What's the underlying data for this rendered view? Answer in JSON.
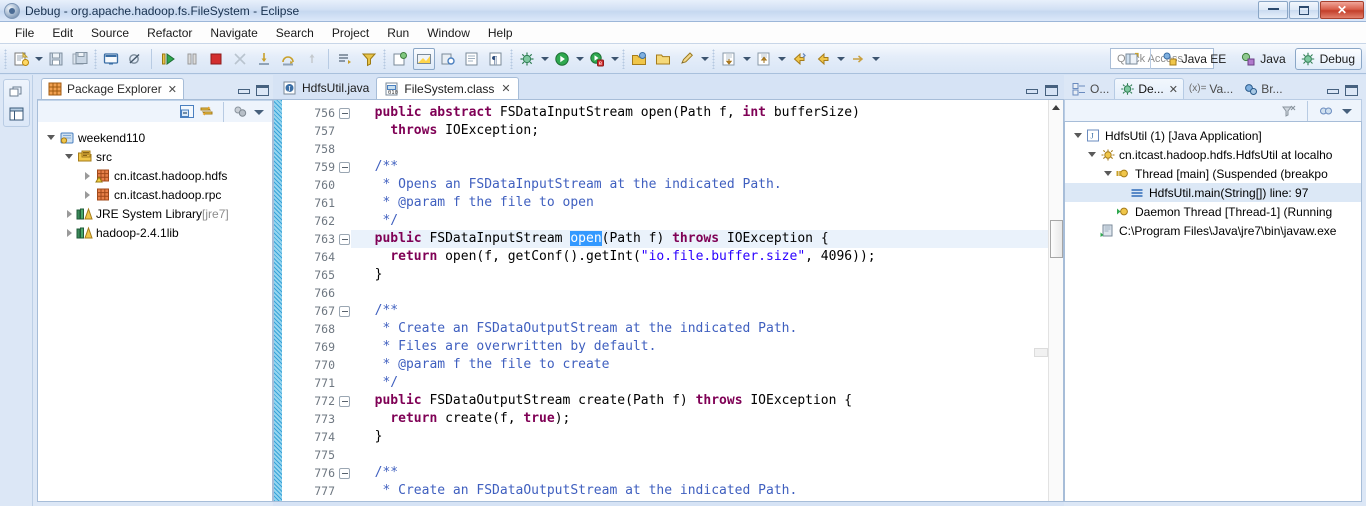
{
  "window": {
    "title": "Debug - org.apache.hadoop.fs.FileSystem - Eclipse",
    "icon": "eclipse-icon",
    "minimize_label": "",
    "maximize_label": "",
    "close_label": "✕"
  },
  "menubar": {
    "items": [
      {
        "label": "File",
        "accel": "F"
      },
      {
        "label": "Edit",
        "accel": "E"
      },
      {
        "label": "Source",
        "accel": "S"
      },
      {
        "label": "Refactor",
        "accel": "t"
      },
      {
        "label": "Navigate",
        "accel": "N"
      },
      {
        "label": "Search",
        "accel": "a"
      },
      {
        "label": "Project",
        "accel": "P"
      },
      {
        "label": "Run",
        "accel": "R"
      },
      {
        "label": "Window",
        "accel": "W"
      },
      {
        "label": "Help",
        "accel": "H"
      }
    ]
  },
  "toolbar": {
    "quick_access_placeholder": "Quick Access",
    "perspectives": [
      {
        "label": "Java EE",
        "icon": "java-ee-perspective-icon",
        "active": false
      },
      {
        "label": "Java",
        "icon": "java-perspective-icon",
        "active": false
      },
      {
        "label": "Debug",
        "icon": "debug-perspective-icon",
        "active": true
      }
    ],
    "open_perspective_icon": "open-perspective-icon",
    "buttons": [
      "new-wizard-icon",
      "save-icon",
      "save-all-icon",
      "console-icon",
      "skip-breakpoints-icon",
      "resume-icon",
      "suspend-icon",
      "terminate-icon",
      "disconnect-icon",
      "step-into-icon",
      "step-over-icon",
      "step-return-icon",
      "drop-to-frame-icon",
      "use-step-filters-icon",
      "debug-launch-icon",
      "run-launch-icon",
      "external-tools-icon",
      "open-type-icon",
      "open-task-icon",
      "search-icon",
      "next-annotation-icon",
      "previous-annotation-icon",
      "back-icon",
      "forward-icon"
    ]
  },
  "fastview": {
    "buttons": [
      "restore-icon",
      "package-explorer-fastview-icon"
    ]
  },
  "package_explorer": {
    "tab_label": "Package Explorer",
    "tab_icon": "package-explorer-icon",
    "close_icon": "✕",
    "toolbar_buttons": [
      "collapse-all-icon",
      "link-with-editor-icon",
      "focus-on-active-task-icon",
      "view-menu-icon"
    ],
    "tree": [
      {
        "label": "weekend110",
        "icon": "java-project-icon",
        "indent": 0,
        "expander": "down"
      },
      {
        "label": "src",
        "icon": "source-folder-icon",
        "indent": 1,
        "expander": "down"
      },
      {
        "label": "cn.itcast.hadoop.hdfs",
        "icon": "package-warning-icon",
        "indent": 2,
        "expander": "right"
      },
      {
        "label": "cn.itcast.hadoop.rpc",
        "icon": "package-icon",
        "indent": 2,
        "expander": "right"
      },
      {
        "label": "JRE System Library",
        "suffix": " [jre7]",
        "icon": "library-icon",
        "indent": 1,
        "expander": "right"
      },
      {
        "label": "hadoop-2.4.1lib",
        "icon": "library-icon",
        "indent": 1,
        "expander": "right"
      }
    ]
  },
  "editor": {
    "tabs": [
      {
        "label": "HdfsUtil.java",
        "icon": "java-file-icon",
        "active": false,
        "closable": false
      },
      {
        "label": "FileSystem.class",
        "icon": "class-file-icon",
        "active": true,
        "closable": true,
        "close_icon": "✕"
      }
    ],
    "controls": [
      "minimize-icon",
      "maximize-icon"
    ],
    "first_line": 756,
    "selection": "open",
    "lines": [
      {
        "n": 756,
        "fold": true,
        "current": false,
        "tokens": [
          {
            "t": "  ",
            "c": "pl"
          },
          {
            "t": "public abstract ",
            "c": "kw"
          },
          {
            "t": "FSDataInputStream open(Path f, ",
            "c": "pl"
          },
          {
            "t": "int",
            "c": "kw"
          },
          {
            "t": " bufferSize)",
            "c": "pl"
          }
        ]
      },
      {
        "n": 757,
        "fold": false,
        "current": false,
        "tokens": [
          {
            "t": "    ",
            "c": "pl"
          },
          {
            "t": "throws",
            "c": "kw"
          },
          {
            "t": " IOException;",
            "c": "pl"
          }
        ]
      },
      {
        "n": 758,
        "fold": false,
        "current": false,
        "tokens": []
      },
      {
        "n": 759,
        "fold": true,
        "current": false,
        "tokens": [
          {
            "t": "  /**",
            "c": "cm"
          }
        ]
      },
      {
        "n": 760,
        "fold": false,
        "current": false,
        "tokens": [
          {
            "t": "   * Opens an FSDataInputStream at the indicated Path.",
            "c": "cm"
          }
        ]
      },
      {
        "n": 761,
        "fold": false,
        "current": false,
        "tokens": [
          {
            "t": "   * @param f the file to open",
            "c": "cm"
          }
        ]
      },
      {
        "n": 762,
        "fold": false,
        "current": false,
        "tokens": [
          {
            "t": "   */",
            "c": "cm"
          }
        ]
      },
      {
        "n": 763,
        "fold": true,
        "current": true,
        "tokens": [
          {
            "t": "  ",
            "c": "pl"
          },
          {
            "t": "public",
            "c": "kw"
          },
          {
            "t": " FSDataInputStream ",
            "c": "pl"
          },
          {
            "t": "open",
            "c": "sel"
          },
          {
            "t": "(Path f) ",
            "c": "pl"
          },
          {
            "t": "throws",
            "c": "kw"
          },
          {
            "t": " IOException {",
            "c": "pl"
          }
        ]
      },
      {
        "n": 764,
        "fold": false,
        "current": false,
        "tokens": [
          {
            "t": "    ",
            "c": "pl"
          },
          {
            "t": "return",
            "c": "kw"
          },
          {
            "t": " open(f, getConf().getInt(",
            "c": "pl"
          },
          {
            "t": "\"io.file.buffer.size\"",
            "c": "str"
          },
          {
            "t": ", 4096));",
            "c": "pl"
          }
        ]
      },
      {
        "n": 765,
        "fold": false,
        "current": false,
        "tokens": [
          {
            "t": "  }",
            "c": "pl"
          }
        ]
      },
      {
        "n": 766,
        "fold": false,
        "current": false,
        "tokens": []
      },
      {
        "n": 767,
        "fold": true,
        "current": false,
        "tokens": [
          {
            "t": "  /**",
            "c": "cm"
          }
        ]
      },
      {
        "n": 768,
        "fold": false,
        "current": false,
        "tokens": [
          {
            "t": "   * Create an FSDataOutputStream at the indicated Path.",
            "c": "cm"
          }
        ]
      },
      {
        "n": 769,
        "fold": false,
        "current": false,
        "tokens": [
          {
            "t": "   * Files are overwritten by default.",
            "c": "cm"
          }
        ]
      },
      {
        "n": 770,
        "fold": false,
        "current": false,
        "tokens": [
          {
            "t": "   * @param f the file to create",
            "c": "cm"
          }
        ]
      },
      {
        "n": 771,
        "fold": false,
        "current": false,
        "tokens": [
          {
            "t": "   */",
            "c": "cm"
          }
        ]
      },
      {
        "n": 772,
        "fold": true,
        "current": false,
        "tokens": [
          {
            "t": "  ",
            "c": "pl"
          },
          {
            "t": "public",
            "c": "kw"
          },
          {
            "t": " FSDataOutputStream create(Path f) ",
            "c": "pl"
          },
          {
            "t": "throws",
            "c": "kw"
          },
          {
            "t": " IOException {",
            "c": "pl"
          }
        ]
      },
      {
        "n": 773,
        "fold": false,
        "current": false,
        "tokens": [
          {
            "t": "    ",
            "c": "pl"
          },
          {
            "t": "return",
            "c": "kw"
          },
          {
            "t": " create(f, ",
            "c": "pl"
          },
          {
            "t": "true",
            "c": "kw"
          },
          {
            "t": ");",
            "c": "pl"
          }
        ]
      },
      {
        "n": 774,
        "fold": false,
        "current": false,
        "tokens": [
          {
            "t": "  }",
            "c": "pl"
          }
        ]
      },
      {
        "n": 775,
        "fold": false,
        "current": false,
        "tokens": []
      },
      {
        "n": 776,
        "fold": true,
        "current": false,
        "tokens": [
          {
            "t": "  /**",
            "c": "cm"
          }
        ]
      },
      {
        "n": 777,
        "fold": false,
        "current": false,
        "tokens": [
          {
            "t": "   * Create an FSDataOutputStream at the indicated Path.",
            "c": "cm"
          }
        ]
      }
    ]
  },
  "debug_view": {
    "tabs": [
      {
        "label": "O...",
        "icon": "outline-icon",
        "active": false
      },
      {
        "label": "De...",
        "icon": "debug-icon",
        "active": true,
        "close_icon": "✕"
      },
      {
        "label": "Va...",
        "icon": "(x)=",
        "active": false
      },
      {
        "label": "Br...",
        "icon": "breakpoints-icon",
        "active": false
      }
    ],
    "controls": [
      "minimize-icon",
      "maximize-icon"
    ],
    "toolbar_buttons": [
      "remove-all-terminated-icon",
      "connect-icon",
      "view-menu-icon"
    ],
    "tree": [
      {
        "label": "HdfsUtil (1) [Java Application]",
        "icon": "launch-icon",
        "indent": 0,
        "expander": "down",
        "selected": false
      },
      {
        "label": "cn.itcast.hadoop.hdfs.HdfsUtil at localho",
        "icon": "debug-target-icon",
        "indent": 1,
        "expander": "down",
        "selected": false
      },
      {
        "label": "Thread [main] (Suspended (breakpo",
        "icon": "thread-suspended-icon",
        "indent": 2,
        "expander": "down",
        "selected": false
      },
      {
        "label": "HdfsUtil.main(String[]) line: 97",
        "icon": "stack-frame-icon",
        "indent": 3,
        "expander": "none",
        "selected": true
      },
      {
        "label": "Daemon Thread [Thread-1] (Running",
        "icon": "thread-running-icon",
        "indent": 2,
        "expander": "none",
        "selected": false
      },
      {
        "label": "C:\\Program Files\\Java\\jre7\\bin\\javaw.exe",
        "icon": "process-icon",
        "indent": 1,
        "expander": "none",
        "selected": false
      }
    ]
  },
  "colors": {
    "titlebar": "#d2e0f4",
    "accent": "#3399ff",
    "keyword": "#7f0055",
    "comment": "#3f5fbf",
    "string": "#2a00ff",
    "selection_bg": "#3399ff",
    "current_line": "#eaf2fb",
    "change_bar": "#8fd3ef"
  }
}
